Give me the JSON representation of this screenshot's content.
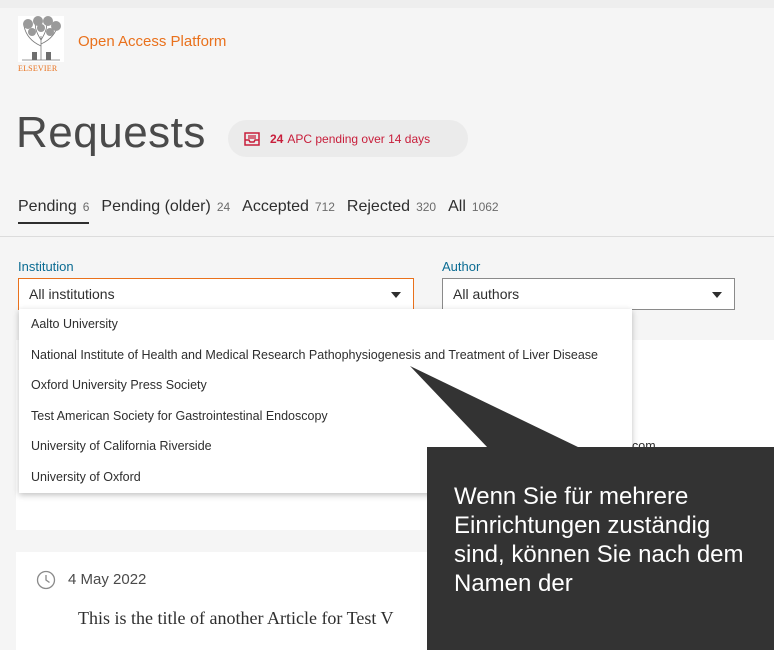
{
  "header": {
    "logo_text": "ELSEVIER",
    "platform_name": "Open Access Platform"
  },
  "page": {
    "title": "Requests"
  },
  "badge": {
    "count": "24",
    "text": "APC pending over 14 days",
    "icon": "inbox-icon"
  },
  "tabs": [
    {
      "label": "Pending",
      "count": "6"
    },
    {
      "label": "Pending (older)",
      "count": "24"
    },
    {
      "label": "Accepted",
      "count": "712"
    },
    {
      "label": "Rejected",
      "count": "320"
    },
    {
      "label": "All",
      "count": "1062"
    }
  ],
  "filters": {
    "institution_label": "Institution",
    "institution_value": "All institutions",
    "author_label": "Author",
    "author_value": "All authors"
  },
  "institution_options": [
    "Aalto University",
    "National Institute of Health and Medical Research Pathophysiogenesis and Treatment of Liver Disease",
    "Oxford University Press Society",
    "Test American Society for Gastrointestinal Endoscopy",
    "University of California Riverside",
    "University of Oxford"
  ],
  "request_card": {
    "email_fragment": "com"
  },
  "second_card": {
    "date": "4 May 2022",
    "article_title": "This is the title of another Article for Test V"
  },
  "tooltip": {
    "text": "Wenn Sie für mehrere Einrichtungen zuständig sind, können Sie nach dem Namen der"
  },
  "colors": {
    "brand": "#e9711c",
    "badge_accent": "#c81e3b",
    "label_blue": "#0b6c93",
    "tooltip_bg": "#333333"
  }
}
